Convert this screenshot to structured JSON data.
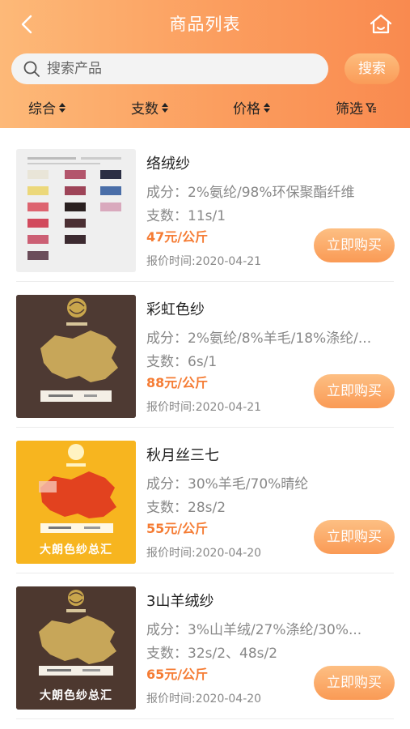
{
  "header": {
    "title": "商品列表",
    "back_icon": "chevron-left-icon",
    "home_icon": "home-icon"
  },
  "search": {
    "placeholder": "搜索产品",
    "value": "",
    "button_label": "搜索"
  },
  "filters": [
    {
      "label": "综合",
      "icon": "sort-arrows-icon"
    },
    {
      "label": "支数",
      "icon": "sort-arrows-icon"
    },
    {
      "label": "价格",
      "icon": "sort-arrows-icon"
    },
    {
      "label": "筛选",
      "icon": "filter-icon"
    }
  ],
  "products": [
    {
      "name": "络绒纱",
      "composition": "成分：2%氨纶/98%环保聚酯纤维",
      "count": "支数：11s/1",
      "price": "47元/公斤",
      "quote_date": "报价时间:2020-04-21",
      "buy_label": "立即购买"
    },
    {
      "name": "彩虹色纱",
      "composition": "成分：2%氨纶/8%羊毛/18%涤纶/...",
      "count": "支数：6s/1",
      "price": "88元/公斤",
      "quote_date": "报价时间:2020-04-21",
      "buy_label": "立即购买"
    },
    {
      "name": "秋月丝三七",
      "composition": "成分：30%羊毛/70%晴纶",
      "count": "支数：28s/2",
      "price": "55元/公斤",
      "quote_date": "报价时间:2020-04-20",
      "buy_label": "立即购买",
      "thumb_text": "大朗色纱总汇"
    },
    {
      "name": "3山羊绒纱",
      "composition": "成分：3%山羊绒/27%涤纶/30%...",
      "count": "支数：32s/2、48s/2",
      "price": "65元/公斤",
      "quote_date": "报价时间:2020-04-20",
      "buy_label": "立即购买",
      "thumb_text": "大朗色纱总汇"
    }
  ],
  "colors": {
    "header_gradient_start": "#fdb978",
    "header_gradient_end": "#f98a4f",
    "price": "#f57c34",
    "button": "#fa9a55"
  }
}
